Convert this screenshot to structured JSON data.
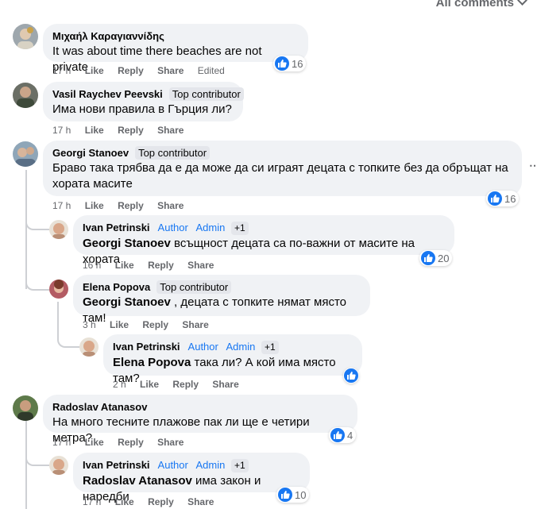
{
  "header": {
    "all_comments": "All comments"
  },
  "comments": [
    {
      "author": "Μιχαήλ Καραγιαννίδης",
      "text": "It was about time there beaches are not private",
      "time": "17 h",
      "like": "Like",
      "reply": "Reply",
      "share": "Share",
      "edited": "Edited",
      "reactions": "16"
    },
    {
      "author": "Vasil Raychev Peevski",
      "badge": "Top contributor",
      "text": "Има нови правила в Гърция ли?",
      "time": "17 h",
      "like": "Like",
      "reply": "Reply",
      "share": "Share"
    },
    {
      "author": "Georgi Stanoev",
      "badge": "Top contributor",
      "text_line1": "Браво така трябва да е да може да си играят децата с топките без да обръщат на",
      "text_line2": "хората масите",
      "time": "17 h",
      "like": "Like",
      "reply": "Reply",
      "share": "Share",
      "reactions": "16"
    },
    {
      "author": "Ivan Petrinski",
      "badge_author": "Author",
      "badge_admin": "Admin",
      "badge_plus": "+1",
      "mention": "Georgi Stanoev",
      "text": " всъщност децата са по-важни от масите на хората",
      "time": "16 h",
      "like": "Like",
      "reply": "Reply",
      "share": "Share",
      "reactions": "20"
    },
    {
      "author": "Elena Popova",
      "badge": "Top contributor",
      "mention": "Georgi Stanoev",
      "text": " , децата с топките нямат място там!",
      "time": "3 h",
      "like": "Like",
      "reply": "Reply",
      "share": "Share"
    },
    {
      "author": "Ivan Petrinski",
      "badge_author": "Author",
      "badge_admin": "Admin",
      "badge_plus": "+1",
      "mention": "Elena Popova",
      "text": " така ли? А кой има място там?",
      "time": "2 h",
      "like": "Like",
      "reply": "Reply",
      "share": "Share"
    },
    {
      "author": "Radoslav Atanasov",
      "text": "На много тесните плажове пак ли ще е четири метра?",
      "time": "17 h",
      "like": "Like",
      "reply": "Reply",
      "share": "Share",
      "reactions": "4"
    },
    {
      "author": "Ivan Petrinski",
      "badge_author": "Author",
      "badge_admin": "Admin",
      "badge_plus": "+1",
      "mention": "Radoslav Atanasov",
      "text": " има закон и наредби",
      "time": "17 h",
      "like": "Like",
      "reply": "Reply",
      "share": "Share",
      "reactions": "10"
    }
  ],
  "colors": {
    "accent": "#1877f2",
    "bubble": "#f0f2f5",
    "meta": "#65676b"
  }
}
